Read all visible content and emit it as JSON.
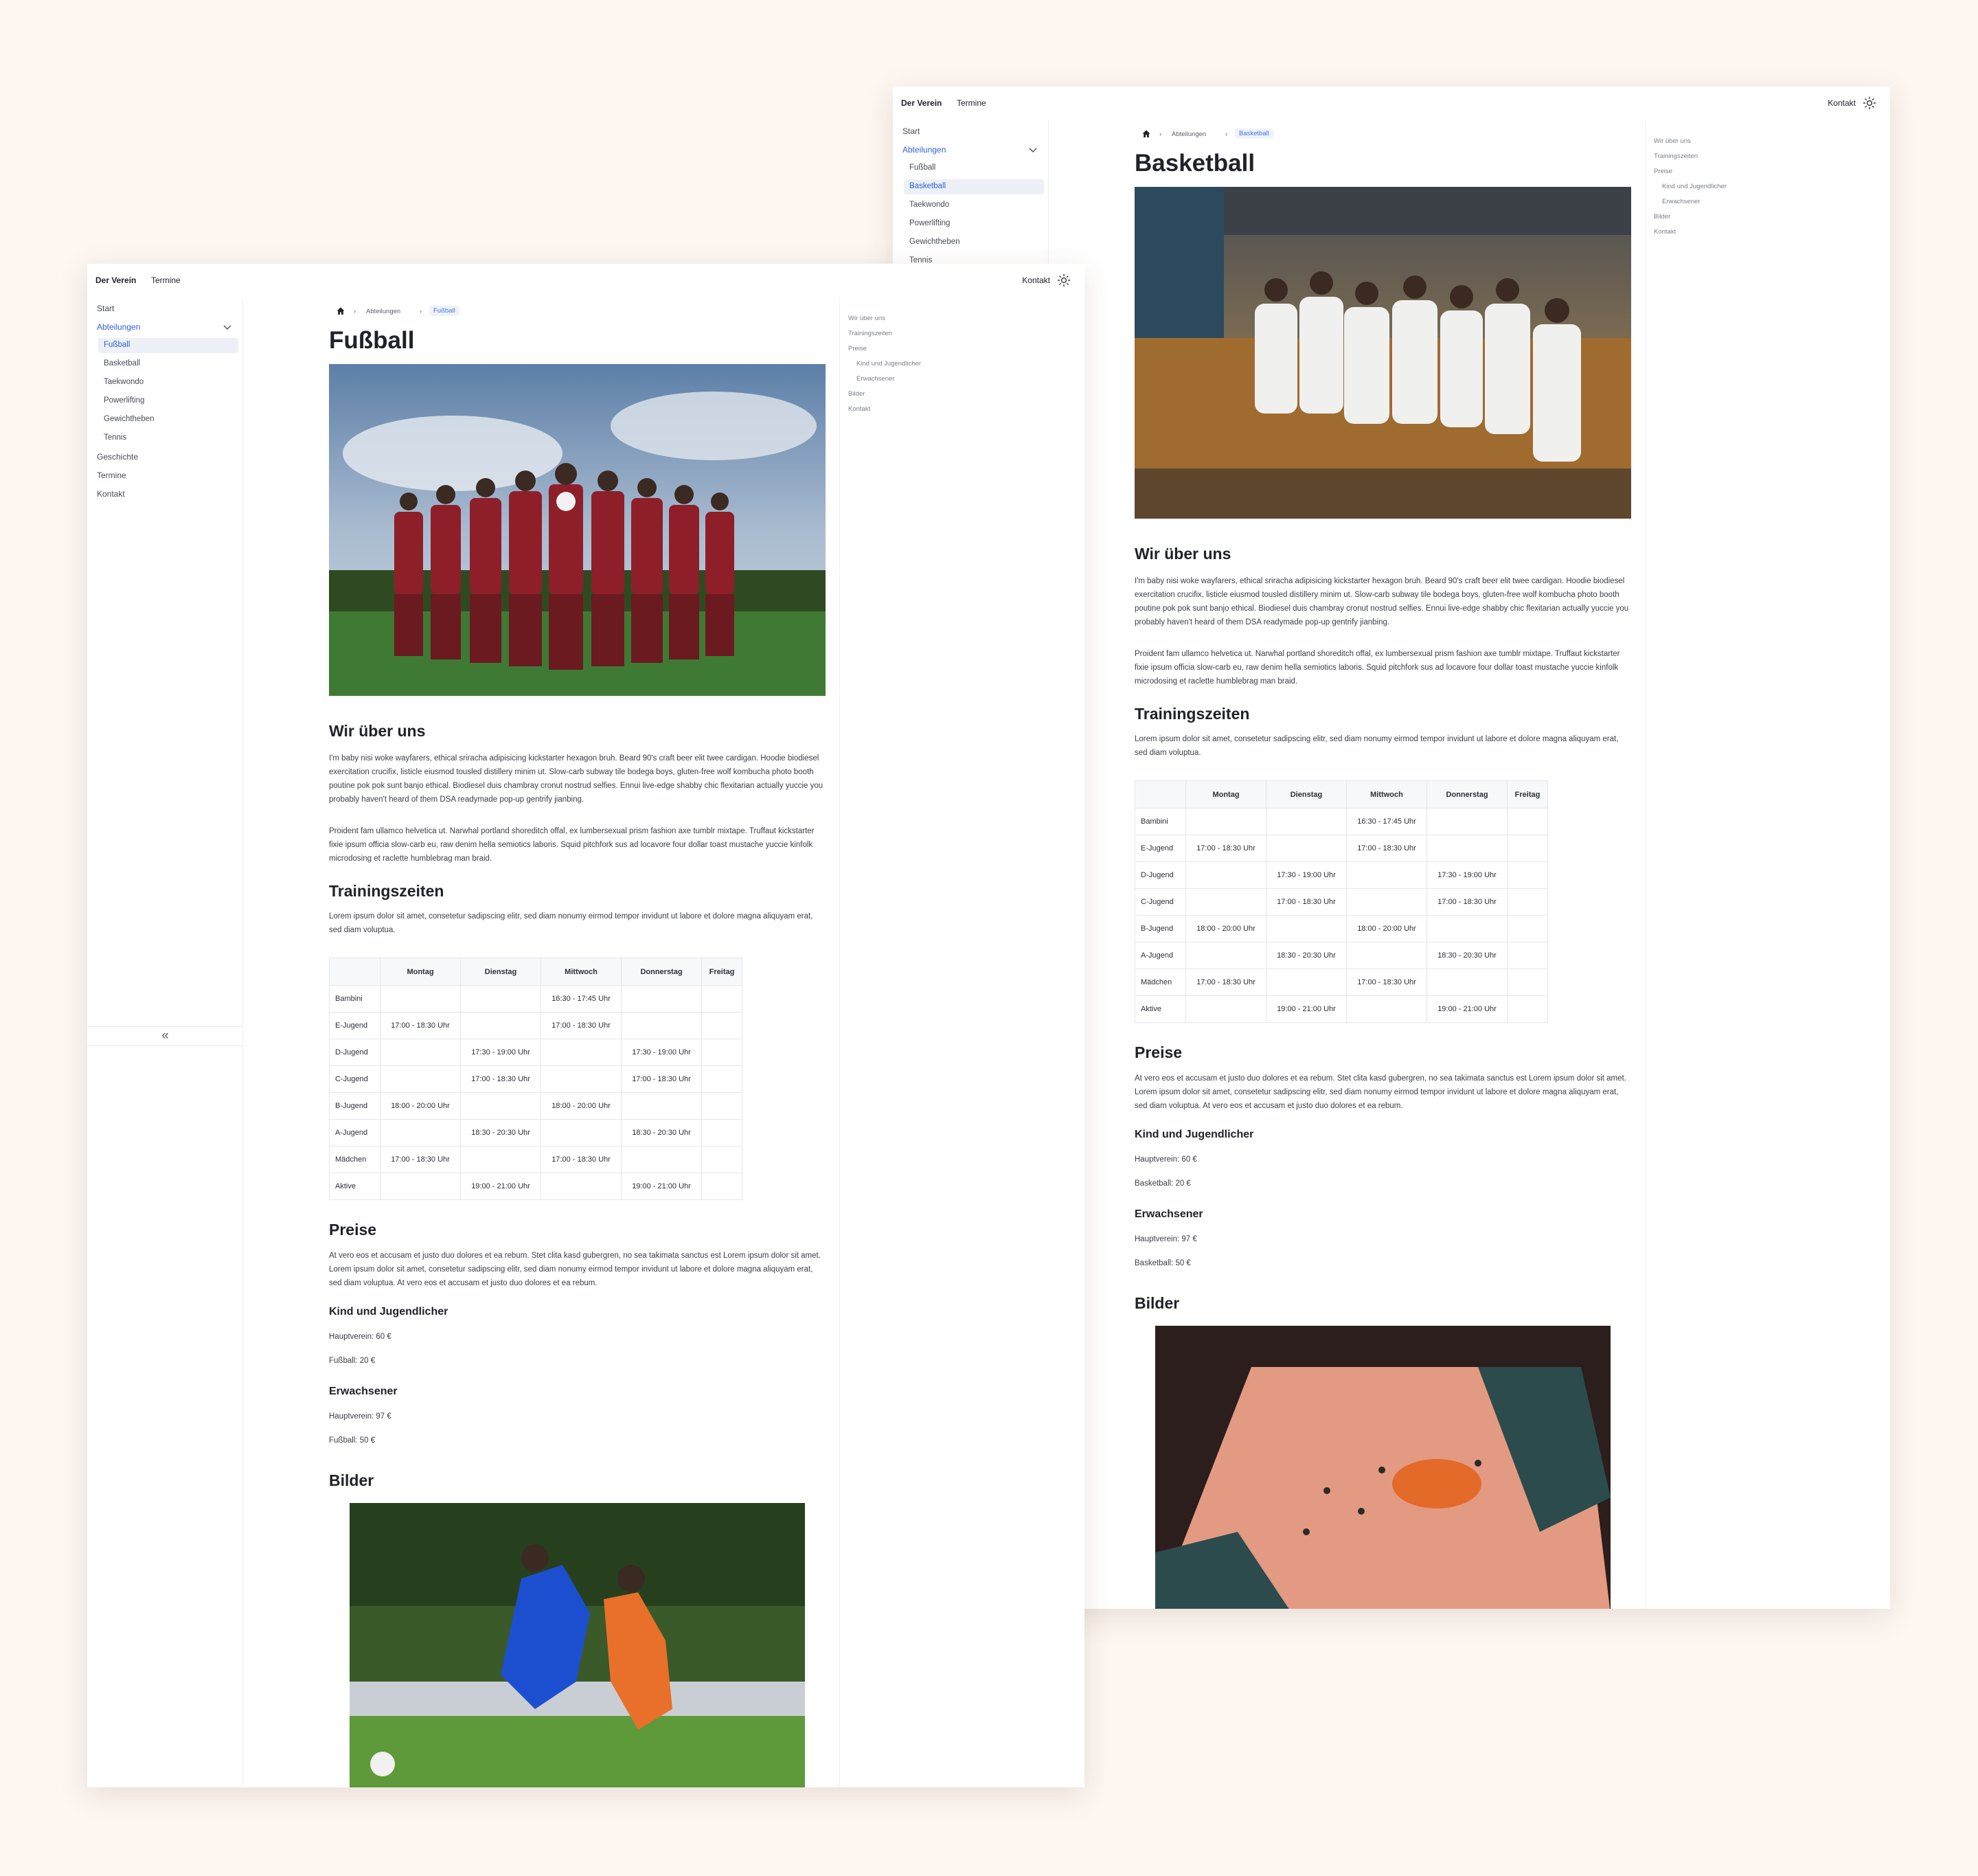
{
  "nav": {
    "brand": "Der Verein",
    "termine": "Termine",
    "kontakt": "Kontakt"
  },
  "sidebar": {
    "items": [
      "Start",
      "Abteilungen",
      "Fußball",
      "Basketball",
      "Taekwondo",
      "Powerlifting",
      "Gewichtheben",
      "Tennis",
      "Geschichte",
      "Termine",
      "Kontakt"
    ],
    "collapse_glyph": "«"
  },
  "toc": [
    "Wir über uns",
    "Trainingszeiten",
    "Preise",
    "Kind und Jugendlicher",
    "Erwachsener",
    "Bilder",
    "Kontakt"
  ],
  "breadcrumb": {
    "parent": "Abteilungen",
    "sep": "›"
  },
  "colors": {
    "accent": "#2f63d6",
    "background": "#fdf6f1",
    "active_bg": "#edf0f6"
  },
  "content": {
    "about_heading": "Wir über uns",
    "about_p1": "I'm baby nisi woke wayfarers, ethical sriracha adipisicing kickstarter hexagon bruh. Beard 90's craft beer elit twee cardigan. Hoodie biodiesel exercitation crucifix, listicle eiusmod tousled distillery minim ut. Slow-carb subway tile bodega boys, gluten-free wolf kombucha photo booth poutine pok pok sunt banjo ethical. Biodiesel duis chambray cronut nostrud selfies. Ennui live-edge shabby chic flexitarian actually yuccie you probably haven't heard of them DSA readymade pop-up gentrify jianbing.",
    "about_p2": "Proident fam ullamco helvetica ut. Narwhal portland shoreditch offal, ex lumbersexual prism fashion axe tumblr mixtape. Truffaut kickstarter fixie ipsum officia slow-carb eu, raw denim hella semiotics laboris. Squid pitchfork sus ad locavore four dollar toast mustache yuccie kinfolk microdosing et raclette humblebrag man braid.",
    "training_heading": "Trainingszeiten",
    "training_p": "Lorem ipsum dolor sit amet, consetetur sadipscing elitr, sed diam nonumy eirmod tempor invidunt ut labore et dolore magna aliquyam erat, sed diam voluptua.",
    "table": {
      "headers": [
        "",
        "Montag",
        "Dienstag",
        "Mittwoch",
        "Donnerstag",
        "Freitag"
      ],
      "rows": [
        [
          "Bambini",
          "",
          "",
          "16:30 - 17:45 Uhr",
          "",
          ""
        ],
        [
          "E-Jugend",
          "17:00 - 18:30 Uhr",
          "",
          "17:00 - 18:30 Uhr",
          "",
          ""
        ],
        [
          "D-Jugend",
          "",
          "17:30 - 19:00 Uhr",
          "",
          "17:30 - 19:00 Uhr",
          ""
        ],
        [
          "C-Jugend",
          "",
          "17:00 - 18:30 Uhr",
          "",
          "17:00 - 18:30 Uhr",
          ""
        ],
        [
          "B-Jugend",
          "18:00 - 20:00 Uhr",
          "",
          "18:00 - 20:00 Uhr",
          "",
          ""
        ],
        [
          "A-Jugend",
          "",
          "18:30 - 20:30 Uhr",
          "",
          "18:30 - 20:30 Uhr",
          ""
        ],
        [
          "Mädchen",
          "17:00 - 18:30 Uhr",
          "",
          "17:00 - 18:30 Uhr",
          "",
          ""
        ],
        [
          "Aktive",
          "",
          "19:00 - 21:00 Uhr",
          "",
          "19:00 - 21:00 Uhr",
          ""
        ]
      ]
    },
    "prices_heading": "Preise",
    "prices_p": "At vero eos et accusam et justo duo dolores et ea rebum. Stet clita kasd gubergren, no sea takimata sanctus est Lorem ipsum dolor sit amet. Lorem ipsum dolor sit amet, consetetur sadipscing elitr, sed diam nonumy eirmod tempor invidunt ut labore et dolore magna aliquyam erat, sed diam voluptua. At vero eos et accusam et justo duo dolores et ea rebum.",
    "kid_heading": "Kind und Jugendlicher",
    "adult_heading": "Erwachsener",
    "gallery_heading": "Bilder"
  },
  "windows": {
    "front": {
      "title": "Fußball",
      "kid_main": "Hauptverein: 60 €",
      "kid_dept": "Fußball: 20 €",
      "adult_main": "Hauptverein: 97 €",
      "adult_dept": "Fußball: 50 €"
    },
    "back": {
      "title": "Basketball",
      "kid_main": "Hauptverein: 60 €",
      "kid_dept": "Basketball: 20 €",
      "adult_main": "Hauptverein: 97 €",
      "adult_dept": "Basketball: 50 €"
    }
  }
}
